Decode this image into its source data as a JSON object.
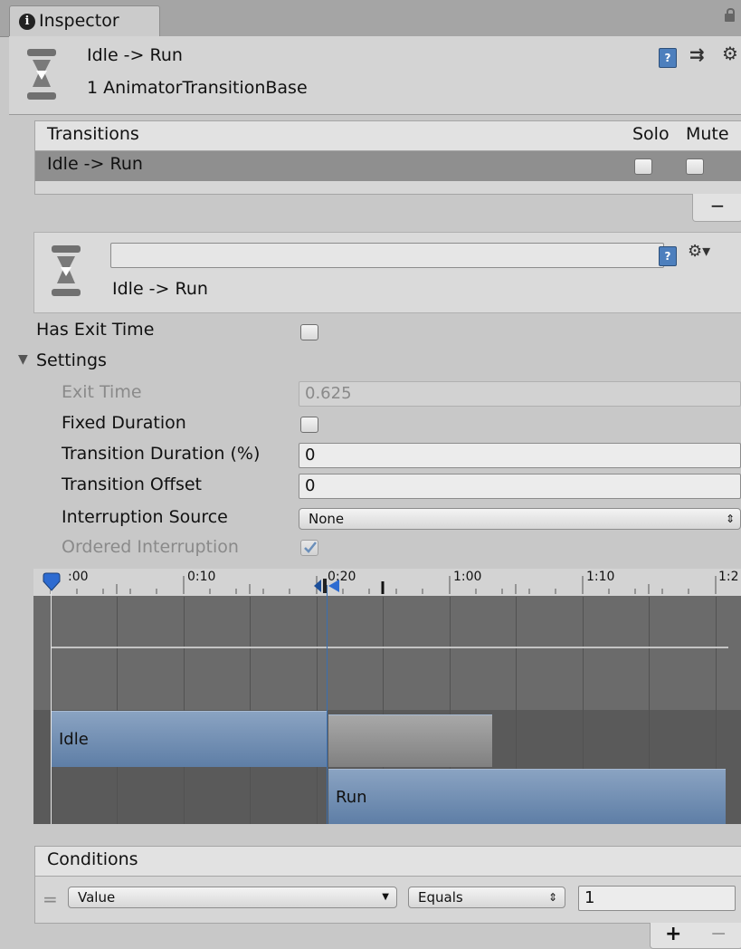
{
  "tab": {
    "label": "Inspector",
    "icon": "info-icon"
  },
  "header": {
    "title": "Idle -> Run",
    "subtitle": "1 AnimatorTransitionBase"
  },
  "transitions": {
    "header": "Transitions",
    "solo_label": "Solo",
    "mute_label": "Mute",
    "rows": [
      {
        "label": "Idle -> Run",
        "solo": false,
        "mute": false
      }
    ],
    "remove_label": "−"
  },
  "transition_panel": {
    "name_value": "",
    "label": "Idle -> Run"
  },
  "has_exit_time": {
    "label": "Has Exit Time",
    "checked": false
  },
  "settings": {
    "label": "Settings",
    "exit_time": {
      "label": "Exit Time",
      "value": "0.625"
    },
    "fixed_duration": {
      "label": "Fixed Duration",
      "checked": false
    },
    "transition_duration": {
      "label": "Transition Duration (%)",
      "value": "0"
    },
    "transition_offset": {
      "label": "Transition Offset",
      "value": "0"
    },
    "interruption_source": {
      "label": "Interruption Source",
      "value": "None"
    },
    "ordered_interruption": {
      "label": "Ordered Interruption",
      "checked": true
    }
  },
  "timeline": {
    "ticks": [
      ":00",
      "0:10",
      "0:20",
      "1:00",
      "1:10",
      "1:2"
    ],
    "tracks": [
      {
        "label": "Idle"
      },
      {
        "label": "Run"
      }
    ]
  },
  "conditions": {
    "header": "Conditions",
    "rows": [
      {
        "parameter": "Value",
        "mode": "Equals",
        "threshold": "1"
      }
    ],
    "add_label": "+",
    "remove_label": "−"
  },
  "colors": {
    "accent": "#4d7fbd",
    "bar": "#6e8db3",
    "playhead": "#2d6bd1"
  }
}
